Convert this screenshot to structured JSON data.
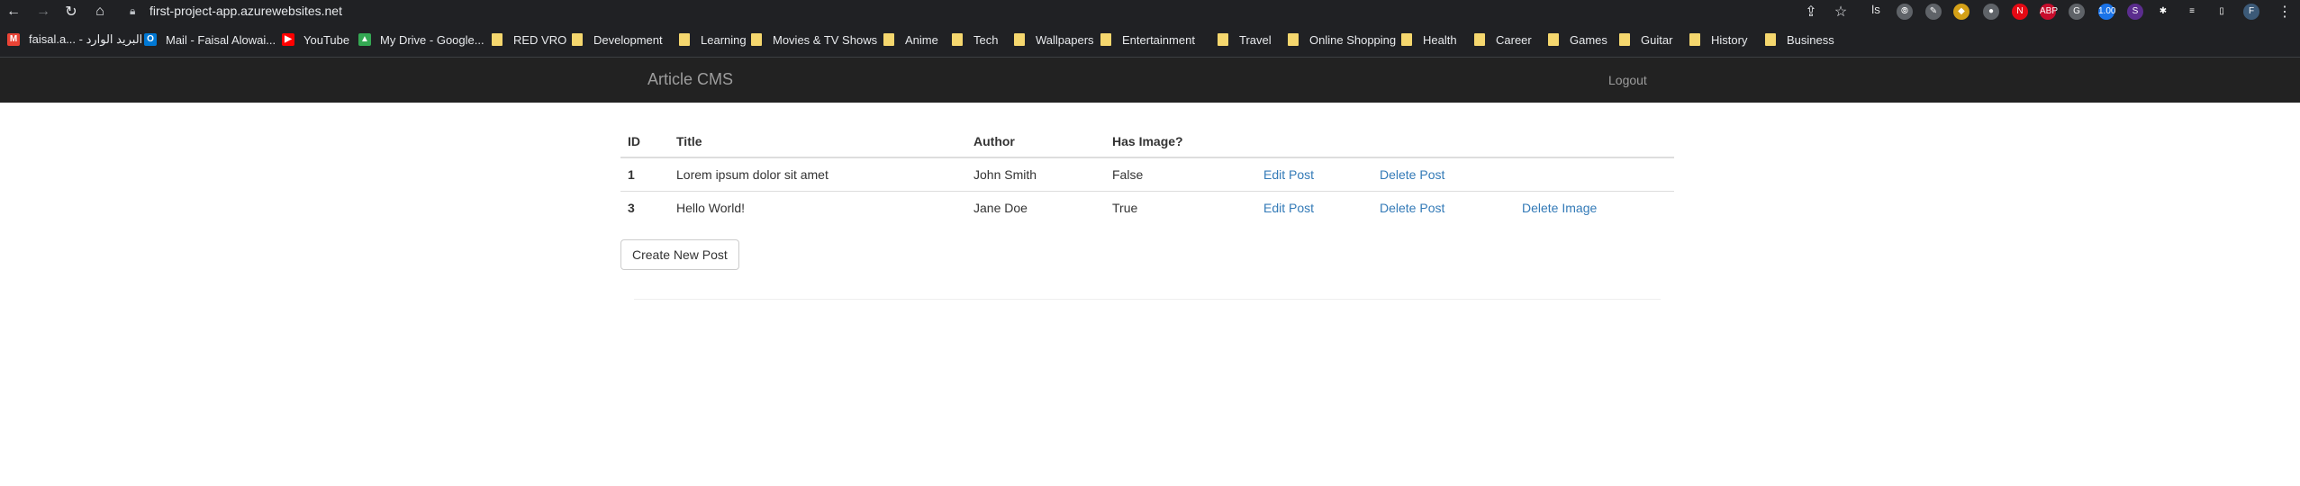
{
  "browser": {
    "url": "first-project-app.azurewebsites.net",
    "extensions": [
      {
        "name": "rs-ext",
        "text": "ꟾS",
        "color": "#202124"
      },
      {
        "name": "colorzilla-ext",
        "text": "⦾",
        "color": "#5f6368"
      },
      {
        "name": "edit-ext",
        "text": "✎",
        "color": "#5f6368"
      },
      {
        "name": "shield-ext",
        "text": "◆",
        "color": "#d4a017"
      },
      {
        "name": "circle-ext",
        "text": "●",
        "color": "#5f6368"
      },
      {
        "name": "n-ext",
        "text": "N",
        "color": "#e50914"
      },
      {
        "name": "abp-ext",
        "text": "ABP",
        "color": "#c70d2c"
      },
      {
        "name": "g-ext",
        "text": "G",
        "color": "#5f6368"
      },
      {
        "name": "counter-ext",
        "text": "1.00",
        "color": "#1a73e8"
      },
      {
        "name": "s-ext",
        "text": "S",
        "color": "#5b2d8e"
      },
      {
        "name": "puzzle-ext",
        "text": "✱",
        "color": "#202124"
      },
      {
        "name": "list-ext",
        "text": "≡",
        "color": "#202124"
      },
      {
        "name": "sidepanel-ext",
        "text": "▯",
        "color": "#202124"
      },
      {
        "name": "profile-ext",
        "text": "F",
        "color": "#3c5a78"
      }
    ]
  },
  "bookmarks": [
    {
      "label": "faisal.a... - البريد الوارد",
      "type": "gmail"
    },
    {
      "label": "Mail - Faisal Alowai...",
      "type": "outlook"
    },
    {
      "label": "YouTube",
      "type": "youtube"
    },
    {
      "label": "My Drive - Google...",
      "type": "drive"
    },
    {
      "label": "RED VRO",
      "type": "folder"
    },
    {
      "label": "Development",
      "type": "folder"
    },
    {
      "label": "Learning",
      "type": "folder"
    },
    {
      "label": "Movies & TV Shows",
      "type": "folder"
    },
    {
      "label": "Anime",
      "type": "folder"
    },
    {
      "label": "Tech",
      "type": "folder"
    },
    {
      "label": "Wallpapers",
      "type": "folder"
    },
    {
      "label": "Entertainment",
      "type": "folder"
    },
    {
      "label": "Travel",
      "type": "folder"
    },
    {
      "label": "Online Shopping",
      "type": "folder"
    },
    {
      "label": "Health",
      "type": "folder"
    },
    {
      "label": "Career",
      "type": "folder"
    },
    {
      "label": "Games",
      "type": "folder"
    },
    {
      "label": "Guitar",
      "type": "folder"
    },
    {
      "label": "History",
      "type": "folder"
    },
    {
      "label": "Business",
      "type": "folder"
    }
  ],
  "navbar": {
    "brand": "Article CMS",
    "logout": "Logout"
  },
  "table": {
    "headers": [
      "ID",
      "Title",
      "Author",
      "Has Image?",
      "",
      "",
      ""
    ],
    "rows": [
      {
        "id": "1",
        "title": "Lorem ipsum dolor sit amet",
        "author": "John Smith",
        "has_image": "False",
        "edit": "Edit Post",
        "delete": "Delete Post",
        "delete_image": ""
      },
      {
        "id": "3",
        "title": "Hello World!",
        "author": "Jane Doe",
        "has_image": "True",
        "edit": "Edit Post",
        "delete": "Delete Post",
        "delete_image": "Delete Image"
      }
    ]
  },
  "create_button": "Create New Post"
}
